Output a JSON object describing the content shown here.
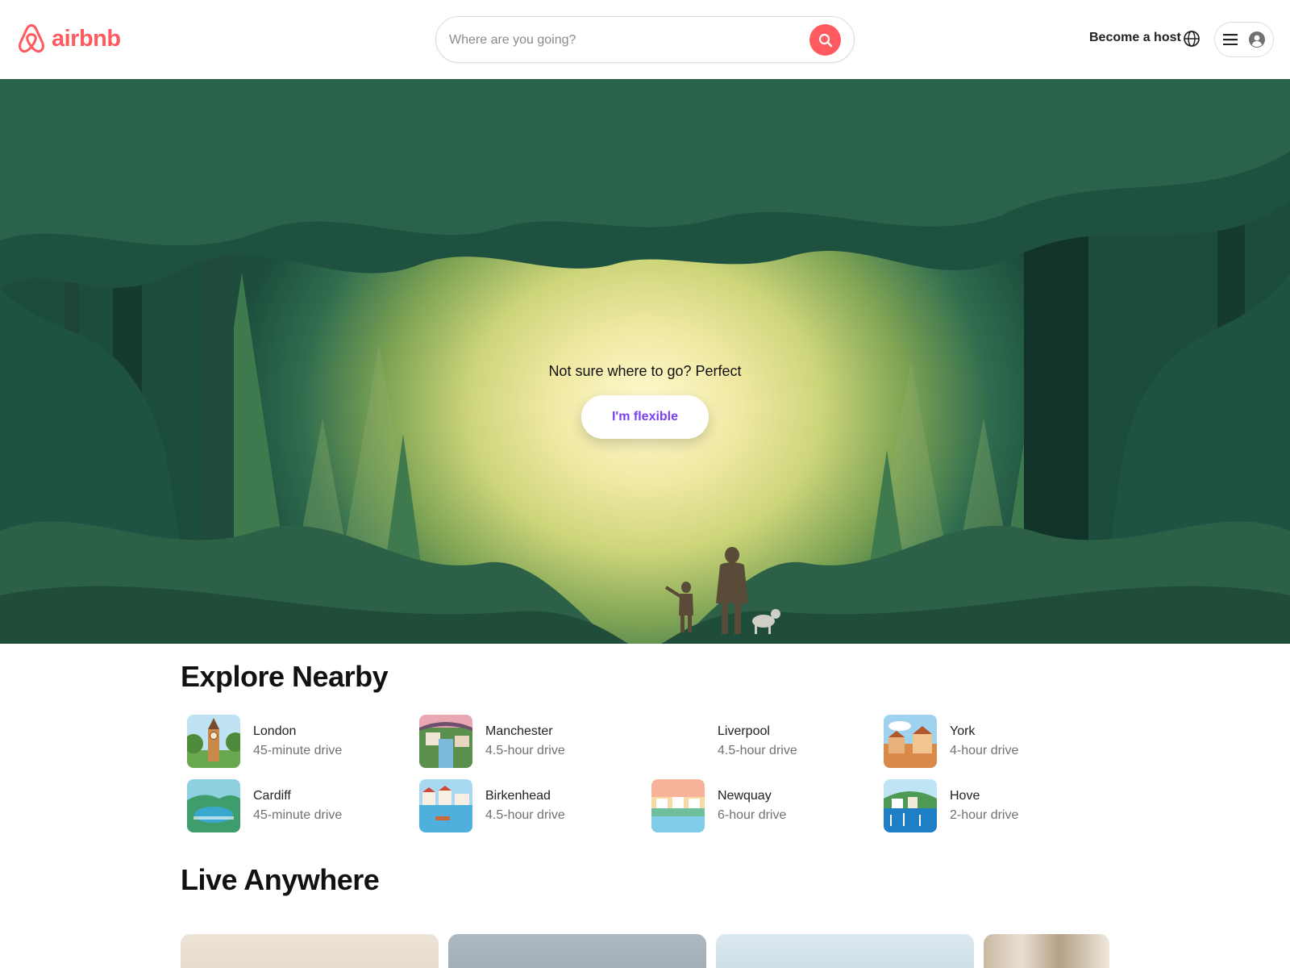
{
  "header": {
    "brand": "airbnb",
    "search_placeholder": "Where are you going?",
    "host_link": "Become a host",
    "accent_color": "#FF5A5F",
    "icons": [
      "airbnb-logo-icon",
      "search-icon",
      "globe-icon",
      "menu-icon",
      "user-avatar-icon"
    ]
  },
  "hero": {
    "tagline": "Not sure where to go? Perfect",
    "cta_label": "I'm flexible",
    "cta_color": "#7b3ff2"
  },
  "explore": {
    "title": "Explore Nearby",
    "places": [
      {
        "name": "London",
        "time": "45-minute drive"
      },
      {
        "name": "Manchester",
        "time": "4.5-hour drive"
      },
      {
        "name": "Liverpool",
        "time": "4.5-hour drive"
      },
      {
        "name": "York",
        "time": "4-hour drive"
      },
      {
        "name": "Cardiff",
        "time": "45-minute drive"
      },
      {
        "name": "Birkenhead",
        "time": "4.5-hour drive"
      },
      {
        "name": "Newquay",
        "time": "6-hour drive"
      },
      {
        "name": "Hove",
        "time": "2-hour drive"
      }
    ]
  },
  "live": {
    "title": "Live Anywhere"
  }
}
